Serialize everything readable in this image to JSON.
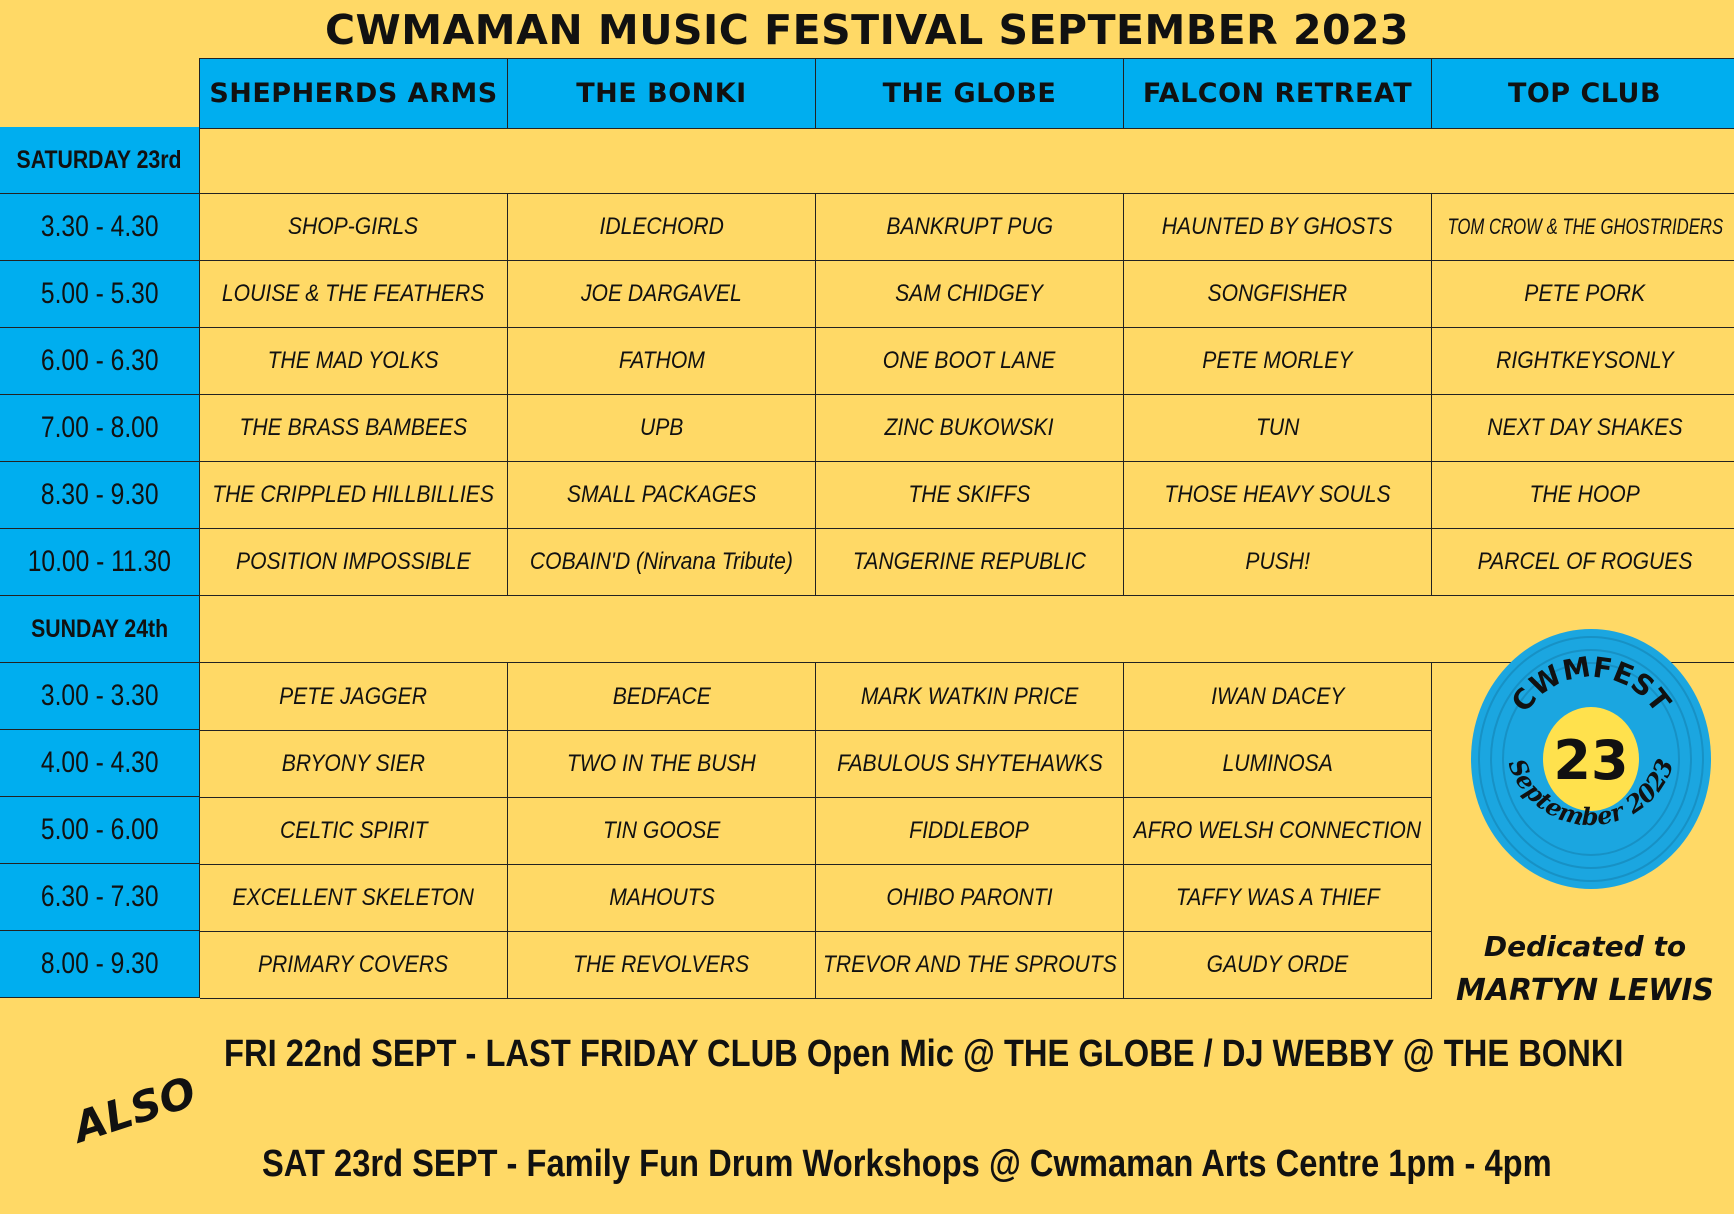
{
  "title": "CWMAMAN MUSIC FESTIVAL SEPTEMBER 2023",
  "venues": [
    "SHEPHERDS ARMS",
    "THE BONKI",
    "THE GLOBE",
    "FALCON RETREAT",
    "TOP CLUB"
  ],
  "saturday": {
    "label": "SATURDAY 23rd",
    "slots": [
      {
        "time": "3.30 - 4.30",
        "acts": [
          "SHOP-GIRLS",
          "IDLECHORD",
          "BANKRUPT PUG",
          "HAUNTED BY GHOSTS",
          "TOM CROW & THE GHOSTRIDERS"
        ]
      },
      {
        "time": "5.00 - 5.30",
        "acts": [
          "LOUISE & THE FEATHERS",
          "JOE DARGAVEL",
          "SAM CHIDGEY",
          "SONGFISHER",
          "PETE PORK"
        ]
      },
      {
        "time": "6.00 - 6.30",
        "acts": [
          "THE MAD YOLKS",
          "FATHOM",
          "ONE BOOT LANE",
          "PETE MORLEY",
          "RIGHTKEYSONLY"
        ]
      },
      {
        "time": "7.00 - 8.00",
        "acts": [
          "THE BRASS BAMBEES",
          "UPB",
          "ZINC BUKOWSKI",
          "TUN",
          "NEXT DAY SHAKES"
        ]
      },
      {
        "time": "8.30 - 9.30",
        "acts": [
          "THE CRIPPLED HILLBILLIES",
          "SMALL PACKAGES",
          "THE SKIFFS",
          "THOSE HEAVY SOULS",
          "THE HOOP"
        ]
      },
      {
        "time": "10.00 - 11.30",
        "acts": [
          "POSITION IMPOSSIBLE",
          "COBAIN'D (Nirvana Tribute)",
          "TANGERINE REPUBLIC",
          "PUSH!",
          "PARCEL OF ROGUES"
        ]
      }
    ]
  },
  "sunday": {
    "label": "SUNDAY 24th",
    "slots": [
      {
        "time": "3.00 - 3.30",
        "acts": [
          "PETE JAGGER",
          "BEDFACE",
          "MARK WATKIN PRICE",
          "IWAN DACEY"
        ]
      },
      {
        "time": "4.00 - 4.30",
        "acts": [
          "BRYONY SIER",
          "TWO IN THE BUSH",
          "FABULOUS SHYTEHAWKS",
          "LUMINOSA"
        ]
      },
      {
        "time": "5.00 - 6.00",
        "acts": [
          "CELTIC SPIRIT",
          "TIN GOOSE",
          "FIDDLEBOP",
          "AFRO WELSH CONNECTION"
        ]
      },
      {
        "time": "6.30 - 7.30",
        "acts": [
          "EXCELLENT SKELETON",
          "MAHOUTS",
          "OHIBO PARONTI",
          "TAFFY WAS A THIEF"
        ]
      },
      {
        "time": "8.00 - 9.30",
        "acts": [
          "PRIMARY COVERS",
          "THE REVOLVERS",
          "TREVOR AND THE SPROUTS",
          "GAUDY ORDE"
        ]
      }
    ]
  },
  "logo": {
    "top": "CWMFEST",
    "center": "23",
    "bottom": "September 2023"
  },
  "dedication": {
    "line1": "Dedicated to",
    "line2": "MARTYN LEWIS"
  },
  "also": {
    "label": "ALSO",
    "line1": "FRI 22nd SEPT - LAST FRIDAY CLUB Open Mic @ THE GLOBE / DJ WEBBY @ THE BONKI",
    "line2": "SAT 23rd SEPT - Family Fun Drum Workshops @ Cwmaman Arts Centre 1pm - 4pm"
  },
  "colors": {
    "background": "#FFD966",
    "accent_blue": "#00AEEF",
    "text": "#111111"
  }
}
